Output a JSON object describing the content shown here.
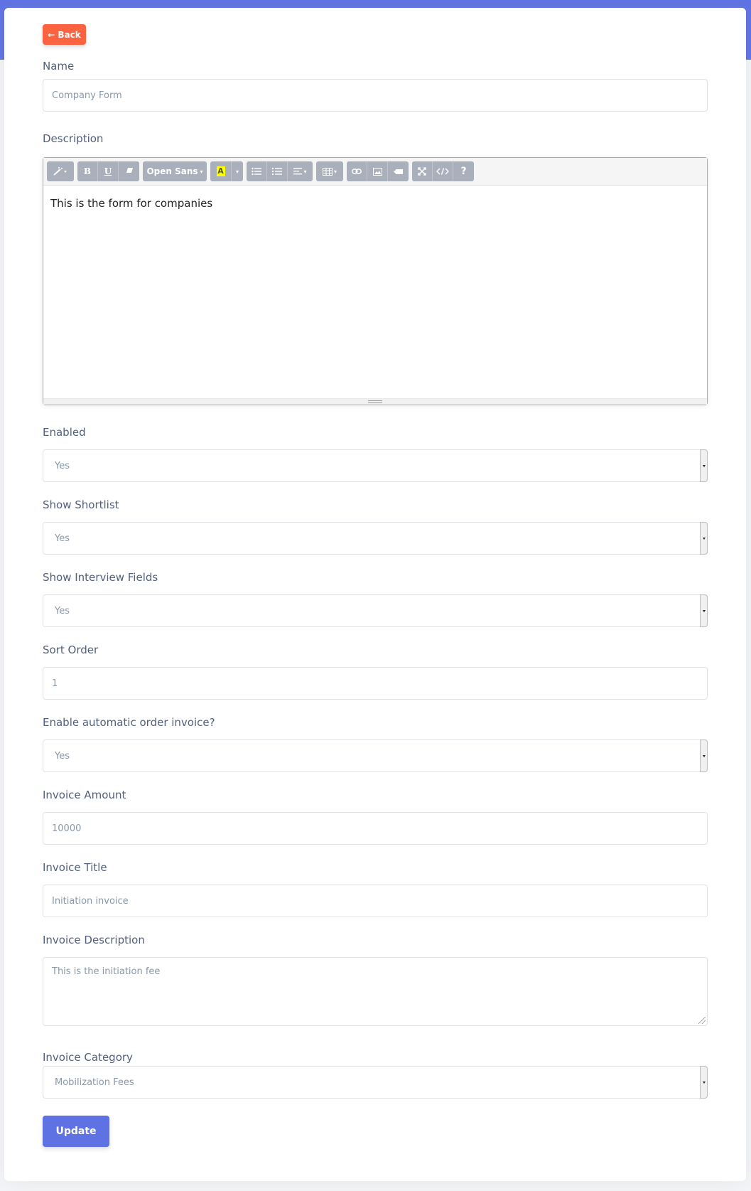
{
  "back_label": "Back",
  "name": {
    "label": "Name",
    "value": "Company Form"
  },
  "description": {
    "label": "Description",
    "toolbar": {
      "font_name": "Open Sans",
      "bold": "B",
      "underline": "U",
      "highlight": "A",
      "help": "?"
    },
    "content": "This is the form for companies"
  },
  "enabled": {
    "label": "Enabled",
    "value": "Yes"
  },
  "show_shortlist": {
    "label": "Show Shortlist",
    "value": "Yes"
  },
  "show_interview_fields": {
    "label": "Show Interview Fields",
    "value": "Yes"
  },
  "sort_order": {
    "label": "Sort Order",
    "value": "1"
  },
  "auto_invoice": {
    "label": "Enable automatic order invoice?",
    "value": "Yes"
  },
  "invoice_amount": {
    "label": "Invoice Amount",
    "value": "10000"
  },
  "invoice_title": {
    "label": "Invoice Title",
    "value": "Initiation invoice"
  },
  "invoice_description": {
    "label": "Invoice Description",
    "value": "This is the initiation fee"
  },
  "invoice_category": {
    "label": "Invoice Category",
    "value": "Mobilization Fees"
  },
  "update_label": "Update",
  "colors": {
    "primary": "#5e72e4",
    "back_button": "#fb6340",
    "toolbar_button": "#a9afbb"
  }
}
